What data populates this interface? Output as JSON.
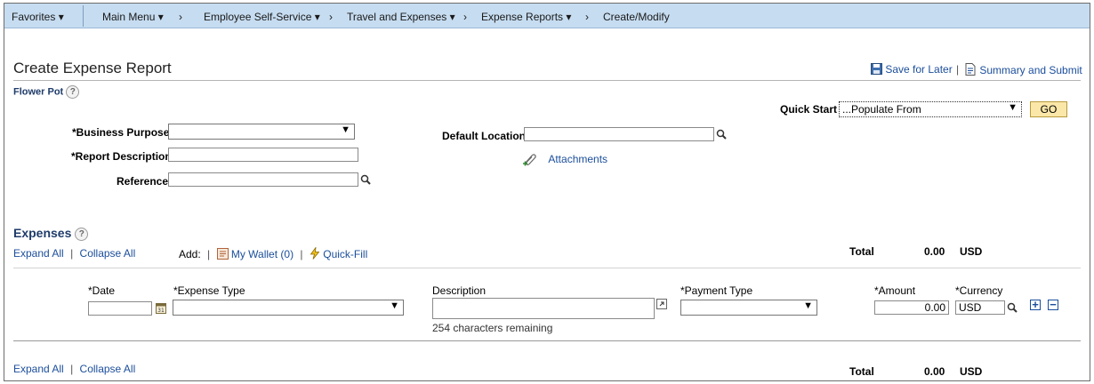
{
  "nav": {
    "favorites": "Favorites",
    "main_menu": "Main Menu",
    "crumbs": [
      "Employee Self-Service",
      "Travel and Expenses",
      "Expense Reports",
      "Create/Modify"
    ]
  },
  "page": {
    "title": "Create Expense Report",
    "employee_name": "Flower Pot",
    "save_for_later": "Save for Later",
    "summary_submit": "Summary and Submit"
  },
  "quick_start": {
    "label": "Quick Start",
    "value": "...Populate From",
    "go_label": "GO"
  },
  "header_fields": {
    "business_purpose_label": "*Business Purpose",
    "report_description_label": "*Report Description",
    "reference_label": "Reference",
    "default_location_label": "Default Location",
    "attachments_label": "Attachments"
  },
  "expenses": {
    "title": "Expenses",
    "expand_all": "Expand All",
    "collapse_all": "Collapse All",
    "add_label": "Add:",
    "my_wallet": "My Wallet (0)",
    "quick_fill": "Quick-Fill",
    "total_label": "Total",
    "total_amount": "0.00",
    "total_currency": "USD"
  },
  "line": {
    "date_label": "*Date",
    "expense_type_label": "*Expense Type",
    "description_label": "Description",
    "payment_type_label": "*Payment Type",
    "amount_label": "*Amount",
    "currency_label": "*Currency",
    "amount_value": "0.00",
    "currency_value": "USD",
    "chars_remaining": "254 characters remaining"
  },
  "colors": {
    "nav_bg": "#c6dcf0",
    "link": "#1b4e9b",
    "go_bg": "#fbe7a8"
  }
}
